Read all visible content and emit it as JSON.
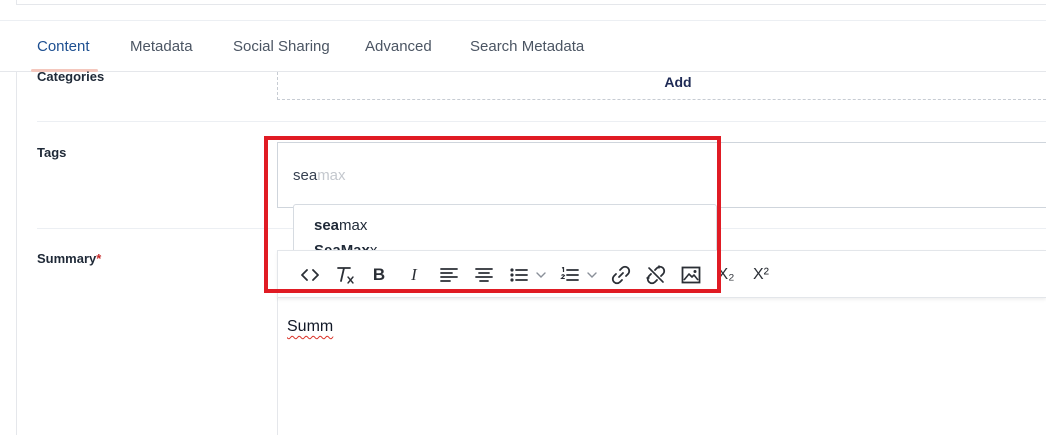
{
  "tabs": [
    {
      "label": "Content",
      "active": true
    },
    {
      "label": "Metadata",
      "active": false
    },
    {
      "label": "Social Sharing",
      "active": false
    },
    {
      "label": "Advanced",
      "active": false
    },
    {
      "label": "Search Metadata",
      "active": false
    }
  ],
  "categories": {
    "label": "Categories",
    "add_label": "Add"
  },
  "tags": {
    "label": "Tags",
    "typed_value": "sea",
    "autocomplete_hint": "max",
    "suggestions": [
      {
        "match": "sea",
        "rest": "max"
      },
      {
        "match": "SeaMax",
        "rest": "x"
      }
    ]
  },
  "summary": {
    "label": "Summary",
    "required_mark": "*",
    "editor_text": "Summ"
  },
  "toolbar": {
    "buttons": [
      {
        "name": "source-code-icon"
      },
      {
        "name": "clear-formatting-icon"
      },
      {
        "name": "bold-icon",
        "glyph": "B"
      },
      {
        "name": "italic-icon",
        "glyph": "I"
      },
      {
        "name": "align-left-icon"
      },
      {
        "name": "align-center-icon"
      },
      {
        "name": "bulleted-list-icon"
      },
      {
        "name": "numbered-list-icon"
      },
      {
        "name": "link-icon"
      },
      {
        "name": "unlink-icon"
      },
      {
        "name": "image-icon"
      },
      {
        "name": "subscript-icon",
        "glyph": "X₂"
      },
      {
        "name": "superscript-icon",
        "glyph": "X²"
      }
    ]
  },
  "colors": {
    "active_tab": "#1d4f91",
    "tab_underline": "#f4c7bd",
    "highlight_border": "#e01b24",
    "required": "#c62828"
  }
}
